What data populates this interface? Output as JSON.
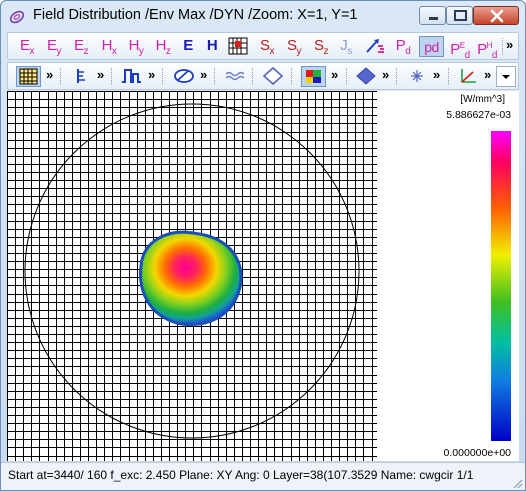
{
  "window": {
    "title": "Field Distribution /Env Max /DYN /Zoom: X=1, Y=1"
  },
  "toolbar1": {
    "buttons": [
      {
        "main": "E",
        "sub": "x"
      },
      {
        "main": "E",
        "sub": "y"
      },
      {
        "main": "E",
        "sub": "z"
      },
      {
        "main": "H",
        "sub": "x"
      },
      {
        "main": "H",
        "sub": "y"
      },
      {
        "main": "H",
        "sub": "z"
      },
      {
        "main": "E",
        "sub": ""
      },
      {
        "main": "H",
        "sub": ""
      },
      {
        "main": "S",
        "sub": "x"
      },
      {
        "main": "S",
        "sub": "y"
      },
      {
        "main": "S",
        "sub": "z"
      },
      {
        "main": "J",
        "sub": "s"
      },
      {
        "main": "P",
        "sub": "d"
      },
      {
        "main": "pd",
        "sub": ""
      },
      {
        "main": "P",
        "sub": "d",
        "sup": "E"
      },
      {
        "main": "P",
        "sub": "d",
        "sup": "H"
      }
    ]
  },
  "colorbar": {
    "unit": "[W/mm^3]",
    "max": "5.886627e-03",
    "min": "0.000000e+00"
  },
  "status": {
    "text": "Start at=3440/ 160  f_exc:  2.450  Plane: XY  Ang:   0  Layer=38(107.3529  Name: cwgcir 1/1"
  },
  "colors": {
    "title_bg": "#c8dbef",
    "grid": "#000000",
    "field_peak": "#ff0090",
    "field_edge": "#1f5fd0"
  }
}
